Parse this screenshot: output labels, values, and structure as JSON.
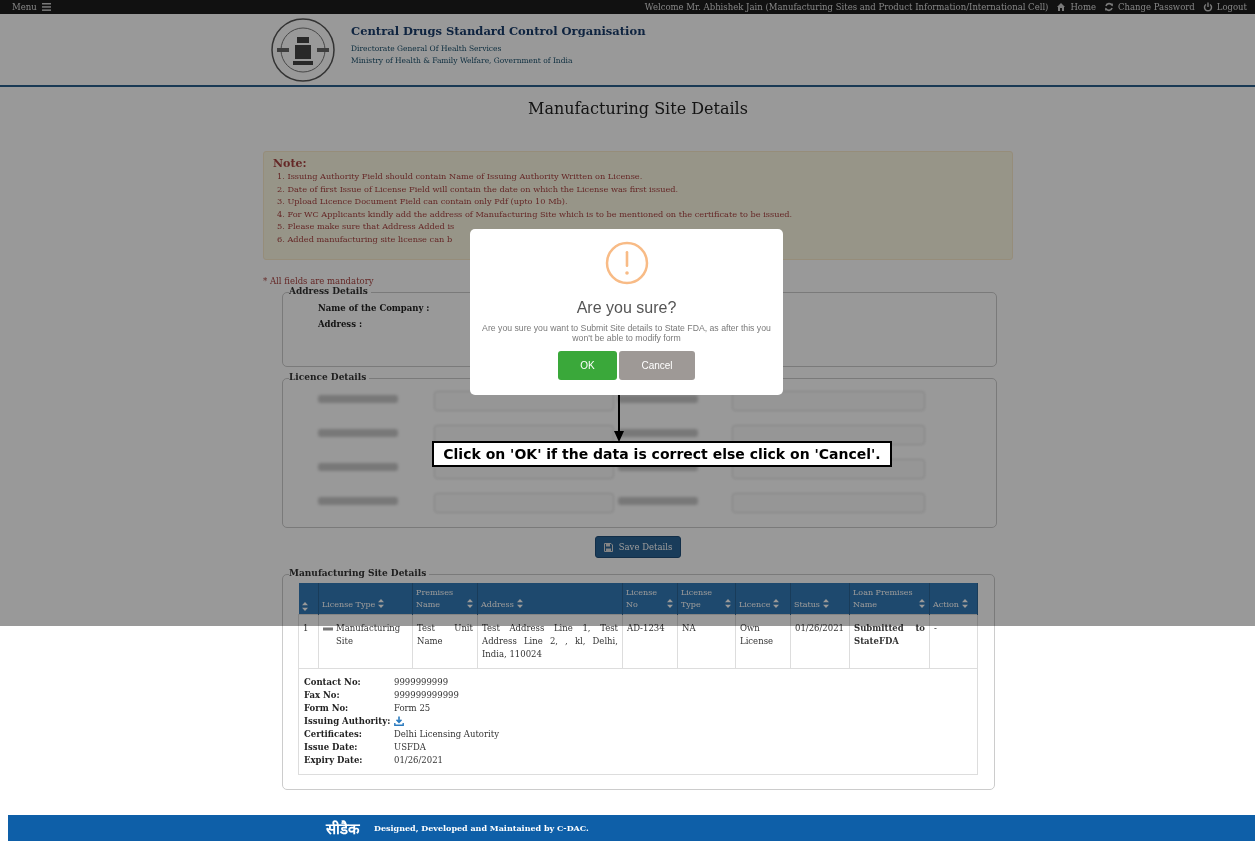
{
  "top_bar": {
    "menu": "Menu",
    "welcome": "Welcome Mr. Abhishek Jain  (Manufacturing Sites and Product Information/International Cell)",
    "links": [
      {
        "kind": "home",
        "label": "Home"
      },
      {
        "kind": "refresh",
        "label": "Change Password"
      },
      {
        "kind": "power",
        "label": "Logout"
      }
    ]
  },
  "header": {
    "title": "Central Drugs Standard Control Organisation",
    "subtitle": "Directorate General Of Health Services",
    "ministry": "Ministry of Health & Family Welfare, Government of India"
  },
  "page_title": "Manufacturing Site Details",
  "note": {
    "heading": "Note:",
    "items": [
      "1. Issuing Authority Field should contain Name of Issuing Authority Written on License.",
      "2. Date of first Issue of License Field will contain the date on which the License was first issued.",
      "3. Upload Licence Document Field can contain only Pdf (upto 10 Mb).",
      "4. For WC Applicants kindly add the address of Manufacturing Site which is to be mentioned on the certificate to be issued.",
      "5. Please make sure that Address Added is",
      "6. Added manufacturing site license can b"
    ]
  },
  "mandatory": "* All fields are mandatory",
  "address": {
    "legend": "Address Details",
    "fields": [
      "Name of the Company :",
      "Address :"
    ]
  },
  "licence": {
    "legend": "Licence Details"
  },
  "save_button": "Save Details",
  "sites": {
    "legend": "Manufacturing Site Details",
    "columns": [
      {
        "kind": "index"
      },
      {
        "kind": "text",
        "label": "License Type"
      },
      {
        "kind": "text",
        "label": "Premises Name"
      },
      {
        "kind": "text",
        "label": "Address"
      },
      {
        "kind": "text",
        "label": "License No"
      },
      {
        "kind": "text",
        "label": "License Type"
      },
      {
        "kind": "text",
        "label": "Licence"
      },
      {
        "kind": "text",
        "label": "Status"
      },
      {
        "kind": "text",
        "label": "Loan Premises Name"
      },
      {
        "kind": "text",
        "label": "Action"
      }
    ],
    "rows": [
      {
        "expanded": true,
        "cells": [
          "1",
          "Manufacturing Site",
          "Test Unit Name",
          "Test Address Line 1, Test Address Line 2, , kl, Delhi, India, 110024",
          "AD-1234",
          "NA",
          "Own License",
          "01/26/2021",
          "Submitted to StateFDA",
          "-"
        ],
        "details": [
          {
            "label": "Contact No:",
            "kind": "text",
            "value": "9999999999"
          },
          {
            "label": "Fax No:",
            "kind": "text",
            "value": "999999999999"
          },
          {
            "label": "Form No:",
            "kind": "text",
            "value": "Form 25"
          },
          {
            "label": "Issuing Authority:",
            "kind": "download"
          },
          {
            "label": "Certificates:",
            "kind": "text",
            "value": "Delhi Licensing Autority"
          },
          {
            "label": "Issue Date:",
            "kind": "text",
            "value": "USFDA"
          },
          {
            "label": "Expiry Date:",
            "kind": "text",
            "value": "01/26/2021"
          }
        ]
      }
    ]
  },
  "footer": {
    "logo": "सीडैक",
    "text": "Designed, Developed and Maintained by C-DAC."
  },
  "dialog": {
    "title": "Are you sure?",
    "message": "Are you sure you want to Submit Site details to State FDA, as after this you won't be able to modify form",
    "ok": "OK",
    "cancel": "Cancel"
  },
  "callout": "Click on 'OK' if the data is correct else click on 'Cancel'."
}
